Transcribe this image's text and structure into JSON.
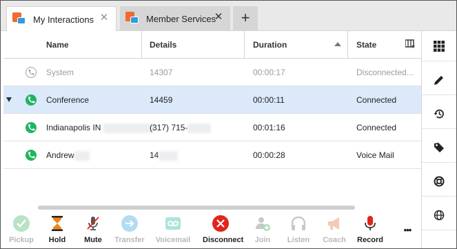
{
  "tabs": [
    {
      "label": "My Interactions",
      "active": true
    },
    {
      "label": "Member Services",
      "active": false
    }
  ],
  "add_tab_label": "+",
  "close_glyph": "✕",
  "columns": [
    "Name",
    "Details",
    "Duration",
    "State"
  ],
  "rows": [
    {
      "name": "System",
      "details": "14307",
      "duration": "00:00:17",
      "state": "Disconnected...",
      "icon": "phone-outline-icon"
    },
    {
      "name": "Conference",
      "details": "14459",
      "duration": "00:00:11",
      "state": "Connected",
      "icon": "phone-green-icon"
    },
    {
      "name": "Indianapolis IN",
      "details": "(317) 715-",
      "duration": "00:01:16",
      "state": "Connected",
      "icon": "phone-green-icon"
    },
    {
      "name": "Andrew",
      "details": "14",
      "duration": "00:00:28",
      "state": "Voice Mail",
      "icon": "phone-green-icon"
    }
  ],
  "toolbar": {
    "pickup": "Pickup",
    "hold": "Hold",
    "mute": "Mute",
    "transfer": "Transfer",
    "voicemail": "Voicemail",
    "disconnect": "Disconnect",
    "join": "Join",
    "listen": "Listen",
    "coach": "Coach",
    "record": "Record",
    "more": "•••"
  },
  "colors": {
    "accent_green": "#1fb55f",
    "disconnect_red": "#e0251b",
    "record_red": "#e0251b",
    "selected_row": "#dbe9fb"
  },
  "sidebar_icons": [
    "grid-icon",
    "pencil-icon",
    "history-icon",
    "tag-icon",
    "lifebuoy-icon",
    "globe-icon"
  ]
}
